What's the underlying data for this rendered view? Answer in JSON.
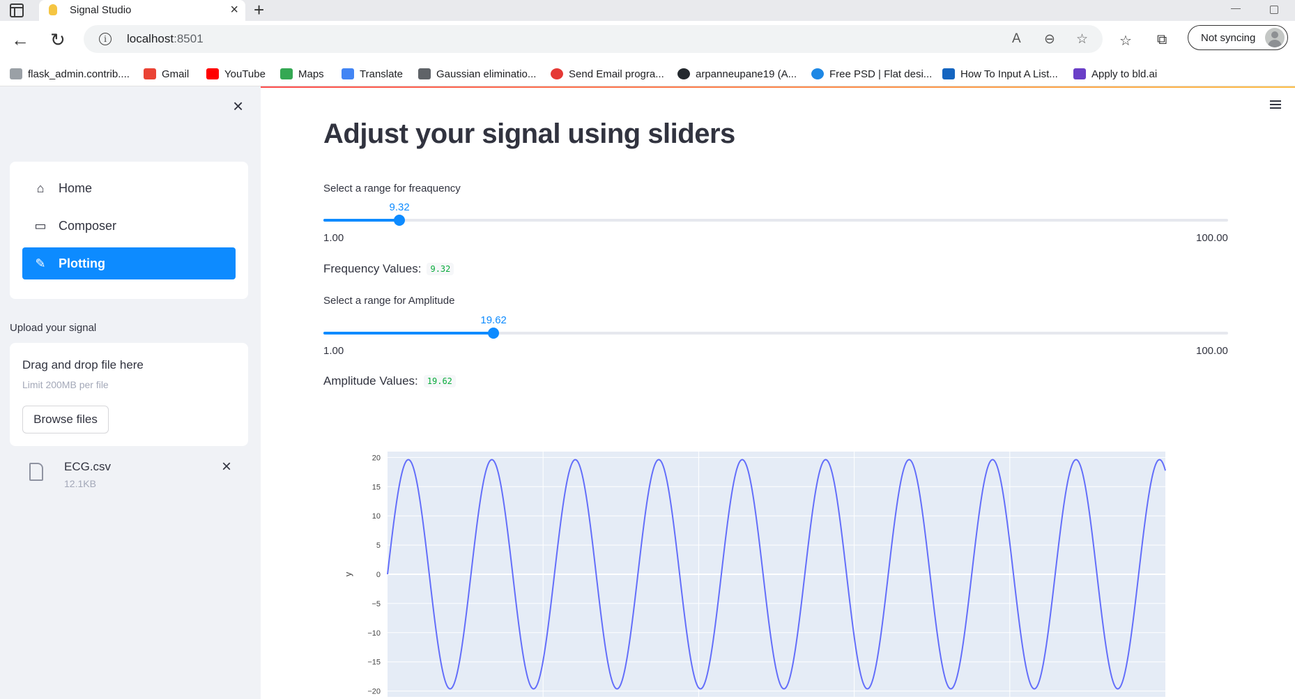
{
  "browser": {
    "tab_title": "Signal Studio",
    "url_host": "localhost",
    "url_port": ":8501",
    "sync_label": "Not syncing",
    "bookmarks": [
      {
        "label": "flask_admin.contrib....",
        "color": "#9aa0a6"
      },
      {
        "label": "Gmail",
        "color": "#ea4335"
      },
      {
        "label": "YouTube",
        "color": "#ff0000"
      },
      {
        "label": "Maps",
        "color": "#34a853"
      },
      {
        "label": "Translate",
        "color": "#4285f4"
      },
      {
        "label": "Gaussian eliminatio...",
        "color": "#5f6368"
      },
      {
        "label": "Send Email progra...",
        "color": "#e53935"
      },
      {
        "label": "arpanneupane19 (A...",
        "color": "#24292e"
      },
      {
        "label": "Free PSD | Flat desi...",
        "color": "#1e88e5"
      },
      {
        "label": "How To Input A List...",
        "color": "#1565c0"
      },
      {
        "label": "Apply to bld.ai",
        "color": "#6a3fc7"
      }
    ]
  },
  "sidebar": {
    "nav": [
      {
        "label": "Home",
        "icon": "home-icon",
        "active": false
      },
      {
        "label": "Composer",
        "icon": "book-icon",
        "active": false
      },
      {
        "label": "Plotting",
        "icon": "pen-icon",
        "active": true
      }
    ],
    "upload_label": "Upload your signal",
    "dropzone_title": "Drag and drop file here",
    "dropzone_limit": "Limit 200MB per file",
    "browse_label": "Browse files",
    "file_name": "ECG.csv",
    "file_size": "12.1KB"
  },
  "main": {
    "title": "Adjust your signal using sliders",
    "freq_slider": {
      "label": "Select a range for freaquency",
      "value": "9.32",
      "value_num": 9.32,
      "min": "1.00",
      "max": "100.00",
      "min_num": 1,
      "max_num": 100
    },
    "freq_values_label": "Frequency Values:",
    "freq_values_code": "9.32",
    "amp_slider": {
      "label": "Select a range for Amplitude",
      "value": "19.62",
      "value_num": 19.62,
      "min": "1.00",
      "max": "100.00",
      "min_num": 1,
      "max_num": 100
    },
    "amp_values_label": "Amplitude Values:",
    "amp_values_code": "19.62"
  },
  "chart_data": {
    "type": "line",
    "ylabel": "y",
    "ylim": [
      -21,
      21
    ],
    "yticks": [
      20,
      15,
      10,
      5,
      0,
      -5,
      -10,
      -15,
      -20
    ],
    "grid": true,
    "series": [
      {
        "amplitude": 19.62,
        "frequency": 9.32,
        "visible_cycles": 9.32,
        "color": "#636efa"
      }
    ]
  },
  "colors": {
    "accent": "#0d8bff",
    "sidebar_bg": "#f0f2f6",
    "code_green": "#09ab3b"
  }
}
